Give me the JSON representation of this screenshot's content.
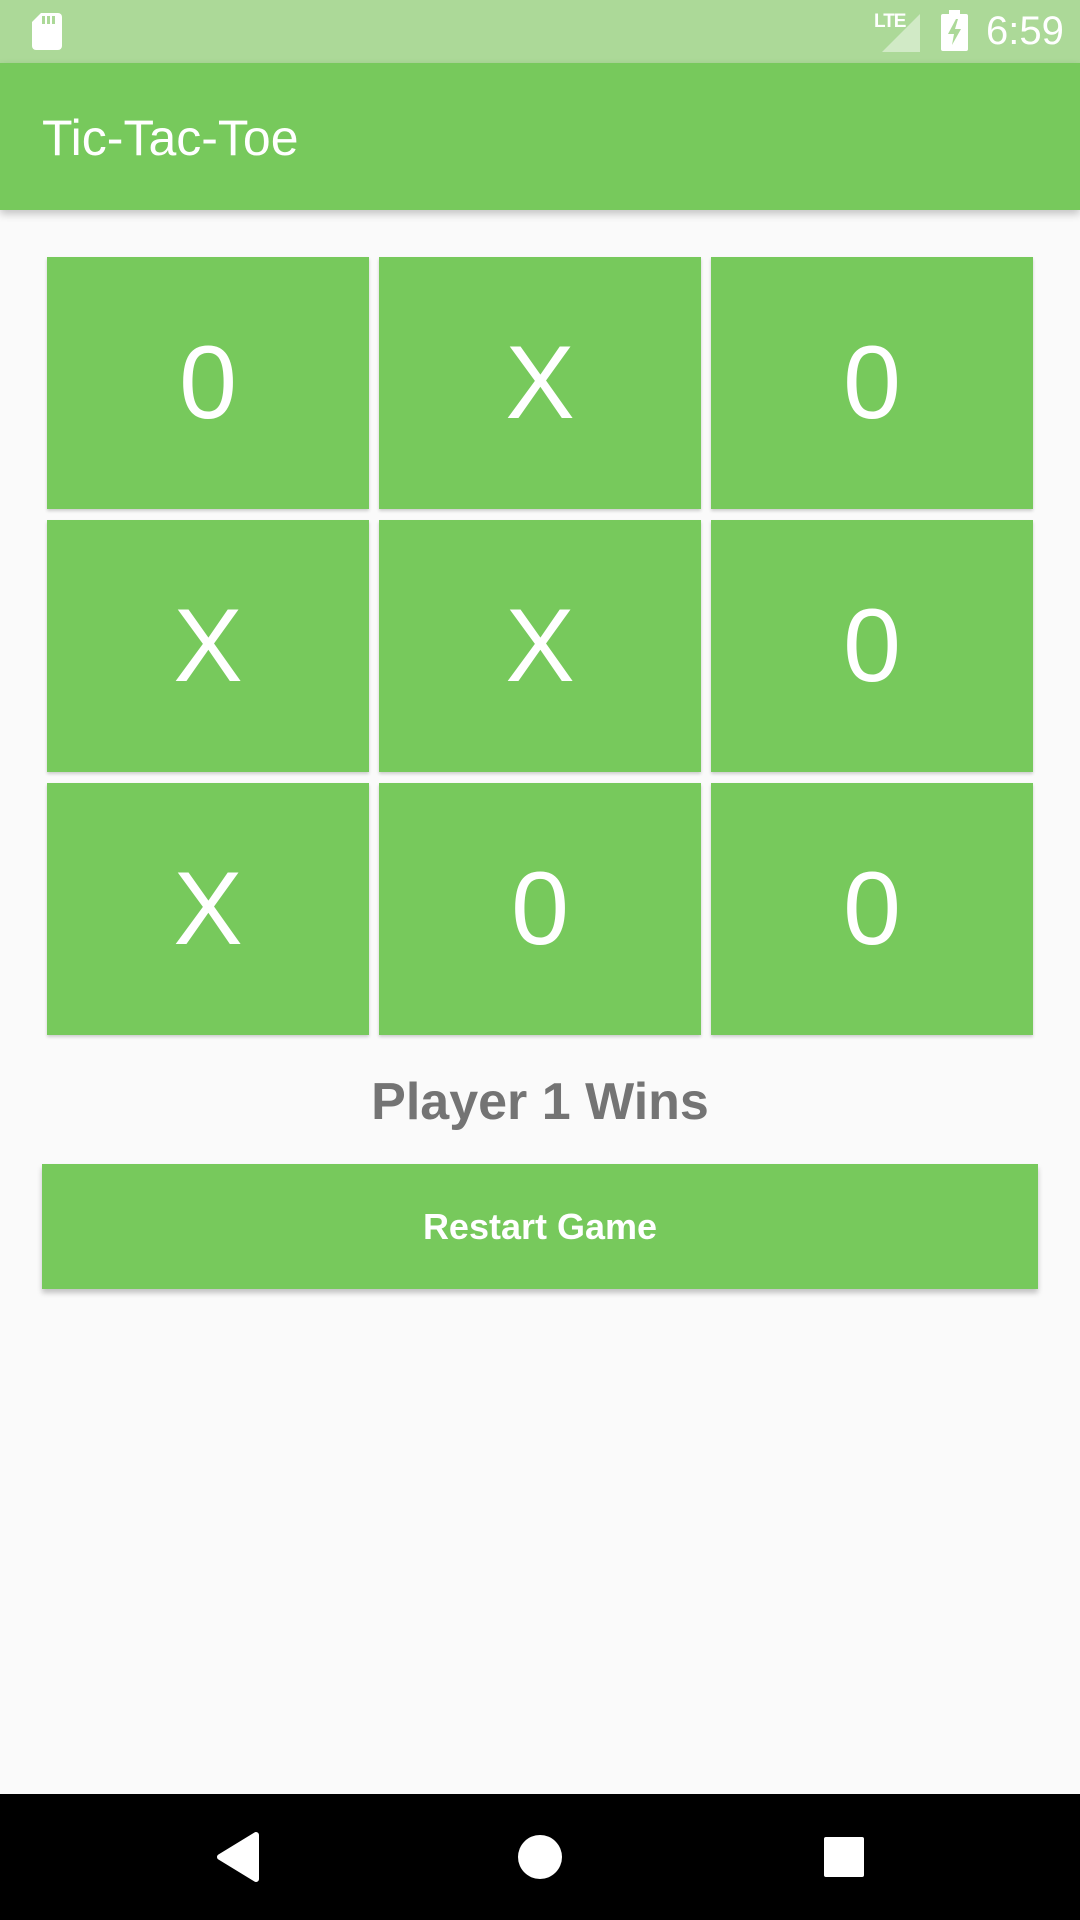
{
  "status_bar": {
    "network": "LTE",
    "time": "6:59",
    "icons": [
      "sd-card-icon",
      "signal-icon",
      "battery-charging-icon"
    ]
  },
  "app_bar": {
    "title": "Tic-Tac-Toe"
  },
  "board": {
    "cells": [
      "0",
      "X",
      "0",
      "X",
      "X",
      "0",
      "X",
      "0",
      "0"
    ]
  },
  "result": "Player 1 Wins",
  "restart_button": "Restart Game",
  "nav_bar": {
    "icons": [
      "back-icon",
      "home-icon",
      "recents-icon"
    ]
  },
  "colors": {
    "primary": "#77c95c",
    "status_bar": "#acd998",
    "background": "#fafafa",
    "result_text": "#747474"
  }
}
